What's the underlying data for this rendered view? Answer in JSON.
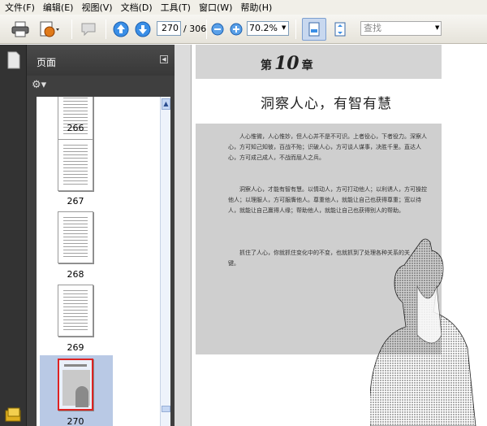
{
  "menu": [
    "文件(F)",
    "编辑(E)",
    "视图(V)",
    "文档(D)",
    "工具(T)",
    "窗口(W)",
    "帮助(H)"
  ],
  "toolbar": {
    "current_page": "270",
    "total_pages": "/ 306",
    "zoom": "70.2%",
    "search_placeholder": "查找"
  },
  "panel": {
    "title": "页面",
    "thumbnails": [
      {
        "label": "266"
      },
      {
        "label": "267"
      },
      {
        "label": "268"
      },
      {
        "label": "269"
      },
      {
        "label": "270",
        "selected": true
      }
    ]
  },
  "document": {
    "chapter_prefix": "第",
    "chapter_number": "10",
    "chapter_suffix": "章",
    "title": "洞察人心，有智有慧",
    "paragraphs": [
      "人心惟微，人心惟妙，但人心并不是不可识。上者役心，下者役力。深察人心，方可知己知彼，百战不殆；识破人心，方可谈人谋事，决胜千里。直达人心，方可成己成人，不战而屈人之兵。",
      "洞察人心，才能有智有慧。以情动人，方可打动他人；以利诱人，方可操控他人；以理服人，方可服膺他人。尊重他人，就能让自己也获得尊重；宽以待人，就能让自己赢得人缘；帮助他人，就能让自己也获得别人的帮助。",
      "抓住了人心，你就抓住变化中的不变，也就抓到了处理各种关系的关键。"
    ]
  }
}
